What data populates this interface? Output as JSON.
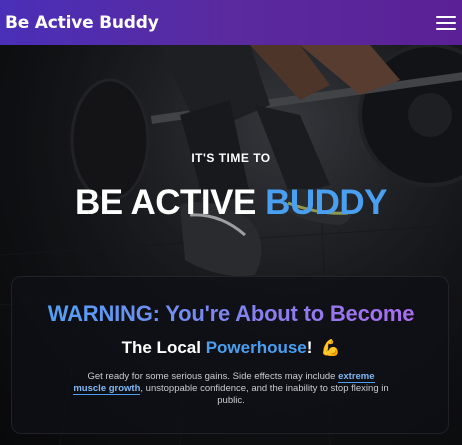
{
  "navbar": {
    "brand": "Be Active Buddy",
    "menu_icon": "hamburger-menu-icon"
  },
  "hero": {
    "kicker": "IT'S TIME TO",
    "headline_prefix": "BE ACTIVE ",
    "headline_accent": "BUDDY"
  },
  "card": {
    "warning": "WARNING: You're About to Become",
    "subhead_prefix": "The Local ",
    "subhead_accent": "Powerhouse",
    "subhead_suffix": "!",
    "subhead_icon": "💪",
    "body_before": "Get ready for some serious gains. Side effects may include ",
    "body_highlight": "extreme muscle growth",
    "body_after": ", unstoppable confidence, and the inability to stop flexing in public."
  },
  "colors": {
    "nav_gradient_start": "#4a2fb8",
    "nav_gradient_end": "#5b2096",
    "accent_blue": "#4a9ff0",
    "accent_purple": "#b169ee"
  }
}
